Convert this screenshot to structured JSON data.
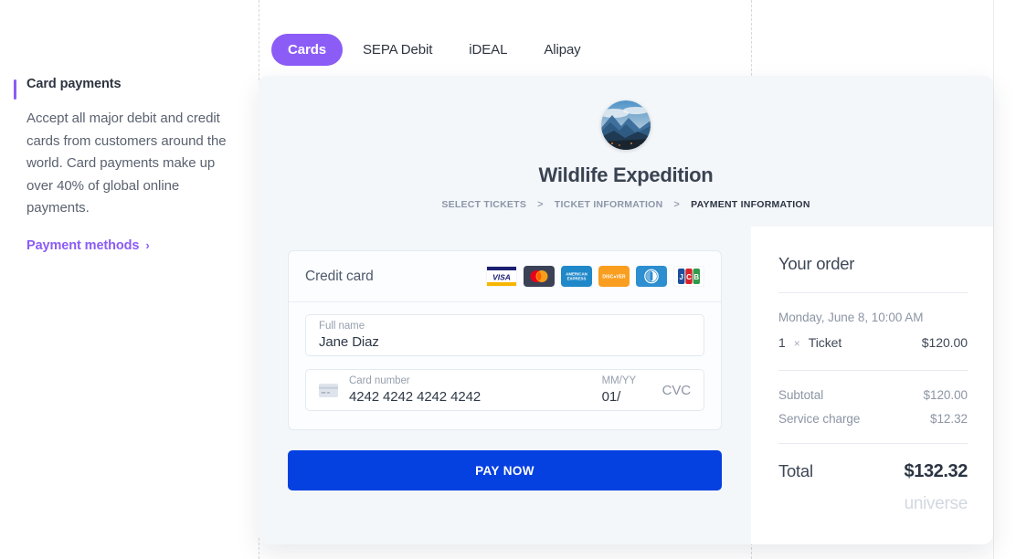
{
  "guides": {
    "count": 3
  },
  "sidebar": {
    "title": "Card payments",
    "body": "Accept all major debit and credit cards from customers around the world. Card payments make up over 40% of global online payments.",
    "link_label": "Payment methods",
    "link_chevron": "chevron-right-icon",
    "accent_color": "#8b5cf6"
  },
  "tabs": {
    "active_color": "#8b5cf6",
    "items": [
      {
        "label": "Cards",
        "active": true
      },
      {
        "label": "SEPA Debit",
        "active": false
      },
      {
        "label": "iDEAL",
        "active": false
      },
      {
        "label": "Alipay",
        "active": false
      }
    ]
  },
  "checkout": {
    "avatar": "event-photo-avatar",
    "event_title": "Wildlife Expedition",
    "breadcrumbs": [
      {
        "label": "SELECT TICKETS",
        "current": false
      },
      {
        "label": "TICKET INFORMATION",
        "current": false
      },
      {
        "label": "PAYMENT INFORMATION",
        "current": true
      }
    ],
    "breadcrumb_separator": ">",
    "payment": {
      "section_label": "Credit card",
      "brands": [
        "visa",
        "mastercard",
        "american-express",
        "discover",
        "diners-club",
        "jcb"
      ],
      "fields": {
        "full_name_label": "Full name",
        "full_name_value": "Jane Diaz",
        "card_number_label": "Card number",
        "card_number_value": "4242 4242 4242 4242",
        "expiry_label": "MM/YY",
        "expiry_value": "01/",
        "cvc_placeholder": "CVC"
      },
      "pay_button": "PAY NOW",
      "pay_button_color": "#0540e0"
    },
    "order": {
      "heading": "Your order",
      "date": "Monday, June 8, 10:00 AM",
      "line_item": {
        "qty": "1",
        "times": "×",
        "name": "Ticket",
        "amount": "$120.00"
      },
      "summary": [
        {
          "label": "Subtotal",
          "amount": "$120.00"
        },
        {
          "label": "Service charge",
          "amount": "$12.32"
        }
      ],
      "total_label": "Total",
      "total_amount": "$132.32",
      "wordmark": "universe"
    }
  }
}
